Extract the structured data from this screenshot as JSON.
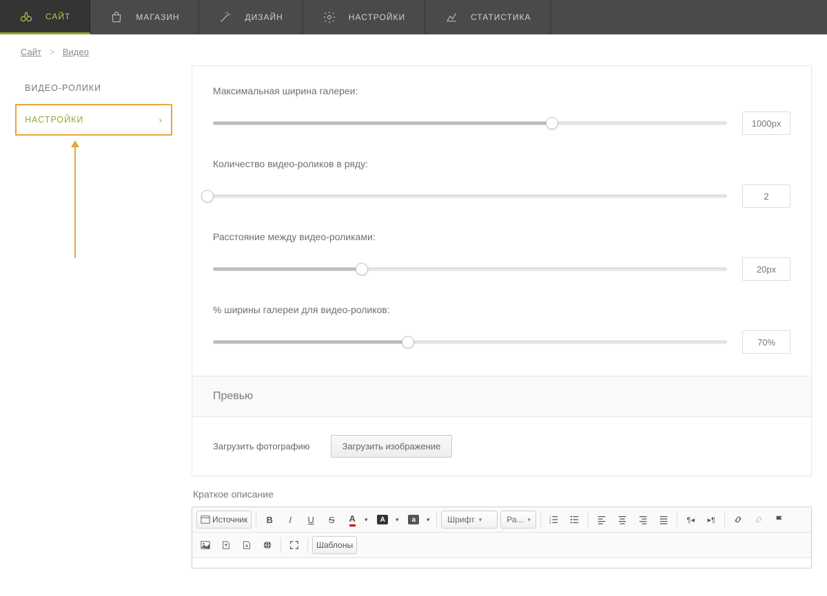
{
  "nav": {
    "items": [
      {
        "label": "САЙТ"
      },
      {
        "label": "МАГАЗИН"
      },
      {
        "label": "ДИЗАЙН"
      },
      {
        "label": "НАСТРОЙКИ"
      },
      {
        "label": "СТАТИСТИКА"
      }
    ]
  },
  "breadcrumb": {
    "root": "Сайт",
    "sep": ">",
    "current": "Видео"
  },
  "side": {
    "items": [
      {
        "label": "ВИДЕО-РОЛИКИ"
      },
      {
        "label": "НАСТРОЙКИ"
      }
    ]
  },
  "settings": {
    "max_width": {
      "label": "Максимальная ширина галереи:",
      "value": "1000px",
      "percent": 66
    },
    "per_row": {
      "label": "Количество видео-роликов в ряду:",
      "value": "2",
      "percent": 0
    },
    "gap": {
      "label": "Расстояние между видео-роликами:",
      "value": "20px",
      "percent": 29
    },
    "width_pct": {
      "label": "% ширины галереи для видео-роликов:",
      "value": "70%",
      "percent": 38
    }
  },
  "preview": {
    "heading": "Превью",
    "upload_label": "Загрузить фотографию",
    "upload_button": "Загрузить изображение"
  },
  "short_desc": {
    "label": "Краткое описание"
  },
  "editor": {
    "source": "Источник",
    "font": "Шрифт",
    "size": "Ра...",
    "templates": "Шаблоны"
  }
}
